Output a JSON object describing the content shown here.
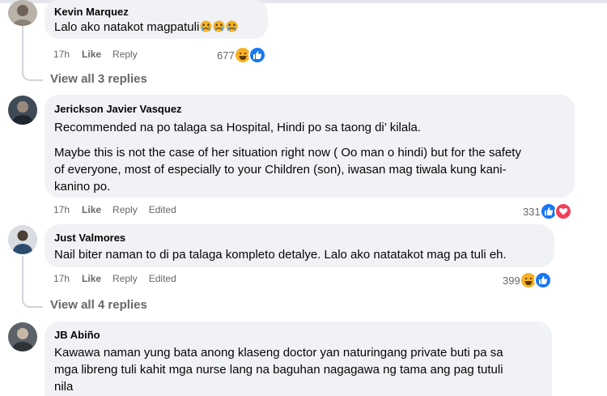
{
  "comments": [
    {
      "author": "Kevin Marquez",
      "text": [
        "Lalo ako natakot magpatuli"
      ],
      "trailing_emoji": "crying-face x3",
      "time": "17h",
      "like_label": "Like",
      "reply_label": "Reply",
      "edited_label": "",
      "reaction_count": "677",
      "reactions": [
        "haha",
        "like"
      ],
      "view_replies": "View all 3 replies"
    },
    {
      "author": "Jerickson Javier Vasquez",
      "text": [
        "Recommended na po talaga sa Hospital, Hindi po sa taong di’ kilala.",
        "Maybe this is not the case of her situation right now ( Oo man o hindi) but for the safety of everyone, most of especially to your Children (son), iwasan mag tiwala kung kani-kanino po."
      ],
      "text_lines_2": [
        "Maybe this is not the case of her situation right now ( Oo man o hindi) but for the safety",
        "of everyone, most of especially to your Children (son), iwasan mag tiwala kung kani-",
        "kanino po."
      ],
      "time": "17h",
      "like_label": "Like",
      "reply_label": "Reply",
      "edited_label": "Edited",
      "reaction_count": "331",
      "reactions": [
        "like",
        "love"
      ]
    },
    {
      "author": "Just Valmores",
      "text": [
        "Nail biter naman to di pa talaga kompleto detalye. Lalo ako natatakot mag pa tuli eh."
      ],
      "time": "17h",
      "like_label": "Like",
      "reply_label": "Reply",
      "edited_label": "Edited",
      "reaction_count": "399",
      "reactions": [
        "haha",
        "like"
      ],
      "view_replies": "View all 4 replies"
    },
    {
      "author": "JB Abiño",
      "text_lines": [
        "Kawawa naman yung bata anong klaseng doctor yan naturingang private buti pa sa",
        "mga libreng tuli kahit mga nurse lang na baguhan nagagawa ng tama ang pag tutuli",
        "nila"
      ]
    }
  ],
  "colors": {
    "bubble": "#f0f2f5",
    "meta": "#65676b",
    "like": "#1877f2",
    "love": "#f33e58",
    "haha": "#f7b125"
  }
}
